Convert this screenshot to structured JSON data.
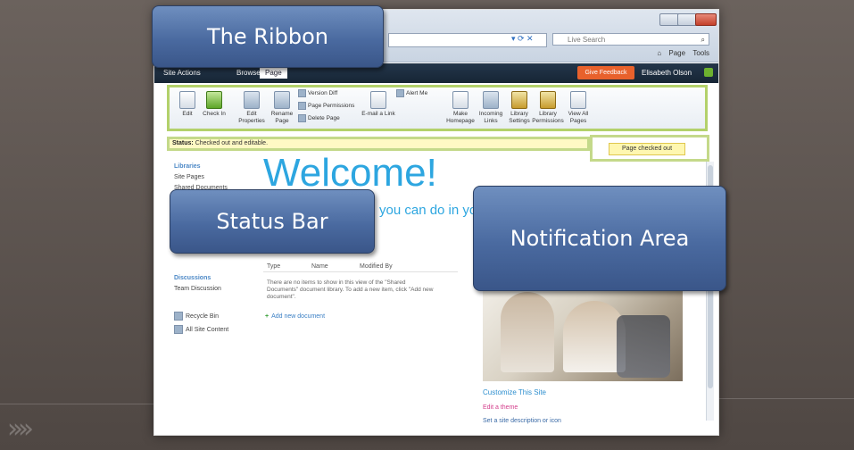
{
  "browser": {
    "search_placeholder": "Live Search",
    "toolbar": [
      "Page",
      "Tools"
    ]
  },
  "sharepoint": {
    "site_actions": "Site Actions",
    "tab_browse": "Browse",
    "tab_page": "Page",
    "feedback_button": "Give Feedback",
    "user": "Elisabeth Olson",
    "ribbon": {
      "edit": "Edit",
      "checkin": "Check In",
      "edit_properties": "Edit Properties",
      "rename_page": "Rename Page",
      "version_diff": "Version Diff",
      "page_permissions": "Page Permissions",
      "delete_page": "Delete Page",
      "email_link": "E-mail a Link",
      "alert_me": "Alert Me",
      "make_homepage": "Make Homepage",
      "incoming_links": "Incoming Links",
      "library_settings": "Library Settings",
      "library_permissions": "Library Permissions",
      "view_all_pages": "View All Pages"
    },
    "status": {
      "label": "Status:",
      "text": "Checked out and editable."
    },
    "notification": "Page checked out",
    "left_nav": {
      "section": "Libraries",
      "items": [
        "Site Pages",
        "Shared Documents"
      ],
      "discussions_header": "Discussions",
      "discussion_item": "Team Discussion",
      "recycle_bin": "Recycle Bin",
      "all_content": "All Site Content"
    },
    "welcome": "Welcome!",
    "welcome_sub": "you can do in you",
    "doc_columns": [
      "Type",
      "Name",
      "Modified By"
    ],
    "doc_empty": "There are no items to show in this view of the \"Shared Documents\" document library. To add a new item, click \"Add new document\".",
    "add_document": "Add new document",
    "customize": "Customize This Site",
    "customize_link": "Edit a theme",
    "site_description": "Set a site description or icon"
  },
  "callouts": {
    "ribbon": "The Ribbon",
    "status_bar": "Status Bar",
    "notification_area": "Notification Area"
  }
}
